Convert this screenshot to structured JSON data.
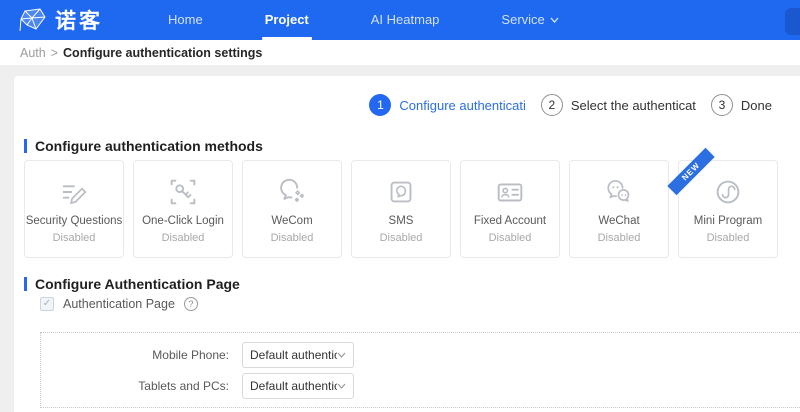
{
  "navbar": {
    "logo_text": "诺客",
    "items": [
      {
        "label": "Home",
        "active": false
      },
      {
        "label": "Project",
        "active": true
      },
      {
        "label": "AI Heatmap",
        "active": false
      },
      {
        "label": "Service",
        "active": false,
        "has_dropdown": true
      }
    ]
  },
  "breadcrumb": {
    "parent": "Auth",
    "separator": ">",
    "current": "Configure authentication settings"
  },
  "steps": {
    "items": [
      {
        "number": "1",
        "label": "Configure authenticati",
        "state": "active"
      },
      {
        "number": "2",
        "label": "Select the authenticat",
        "state": "pending"
      },
      {
        "number": "3",
        "label": "Done",
        "state": "pending"
      }
    ]
  },
  "methods_section": {
    "title": "Configure authentication methods",
    "items": [
      {
        "label": "Security Questions",
        "status": "Disabled",
        "icon": "security-questions-icon"
      },
      {
        "label": "One-Click Login",
        "status": "Disabled",
        "icon": "one-click-login-key-icon"
      },
      {
        "label": "WeCom",
        "status": "Disabled",
        "icon": "wecom-chat-icon"
      },
      {
        "label": "SMS",
        "status": "Disabled",
        "icon": "sms-bubble-icon"
      },
      {
        "label": "Fixed Account",
        "status": "Disabled",
        "icon": "id-card-icon"
      },
      {
        "label": "WeChat",
        "status": "Disabled",
        "icon": "wechat-icon"
      },
      {
        "label": "Mini Program",
        "status": "Disabled",
        "icon": "mini-program-icon",
        "badge": "NEW"
      }
    ]
  },
  "page_section": {
    "title": "Configure Authentication Page",
    "checkbox": {
      "label": "Authentication Page",
      "checked": true,
      "check_glyph": "✓",
      "help_glyph": "?"
    },
    "form": {
      "rows": [
        {
          "label": "Mobile Phone:",
          "value": "Default authenticatio..."
        },
        {
          "label": "Tablets and PCs:",
          "value": "Default authenticatio..."
        }
      ]
    }
  },
  "colors": {
    "navbar_background": "#1F68F0",
    "accent_blue": "#2468F2",
    "ribbon_blue": "#2B6FE0",
    "disabled_text": "#A8A8A8",
    "card_border": "#E9E9E9"
  }
}
